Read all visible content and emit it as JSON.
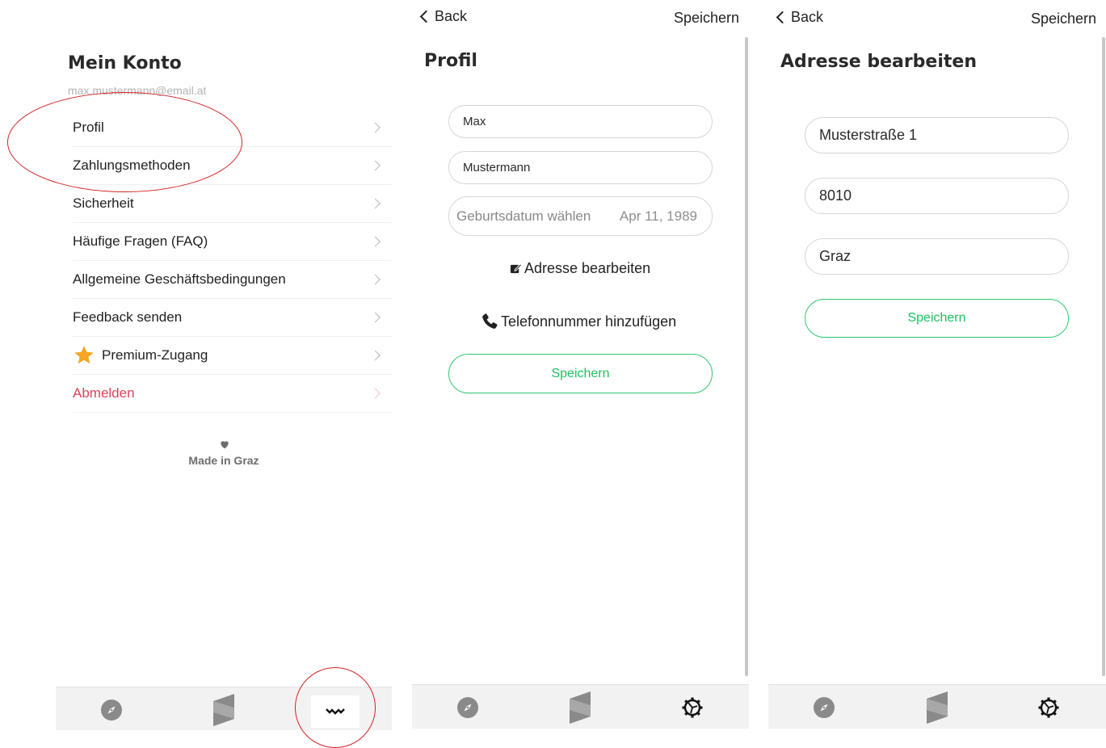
{
  "konto": {
    "title": "Mein Konto",
    "email": "max.mustermann@email.at",
    "menu": [
      {
        "label": "Profil"
      },
      {
        "label": "Zahlungsmethoden"
      },
      {
        "label": "Sicherheit"
      },
      {
        "label": "Häufige Fragen (FAQ)"
      },
      {
        "label": "Allgemeine Geschäftsbedingungen"
      },
      {
        "label": "Feedback senden"
      },
      {
        "label": "Premium-Zugang",
        "icon": "star-icon"
      },
      {
        "label": "Abmelden"
      }
    ],
    "made_in": "Made in Graz",
    "colors": {
      "logout": "#d9435a",
      "star": "#f5a623"
    }
  },
  "profil": {
    "back_label": "Back",
    "save_top_label": "Speichern",
    "title": "Profil",
    "first_name": "Max",
    "last_name": "Mustermann",
    "birthdate_placeholder": "Geburtsdatum wählen",
    "birthdate_value": "Apr 11, 1989",
    "edit_address_label": "Adresse bearbeiten",
    "add_phone_label": "Telefonnummer hinzufügen",
    "save_label": "Speichern"
  },
  "adresse": {
    "back_label": "Back",
    "save_top_label": "Speichern",
    "title": "Adresse bearbeiten",
    "street": "Musterstraße 1",
    "zip": "8010",
    "city": "Graz",
    "save_label": "Speichern",
    "accent_color": "#1fbf63"
  },
  "navbar": {
    "items": [
      "compass-icon",
      "map-icon",
      "gear-icon"
    ]
  }
}
